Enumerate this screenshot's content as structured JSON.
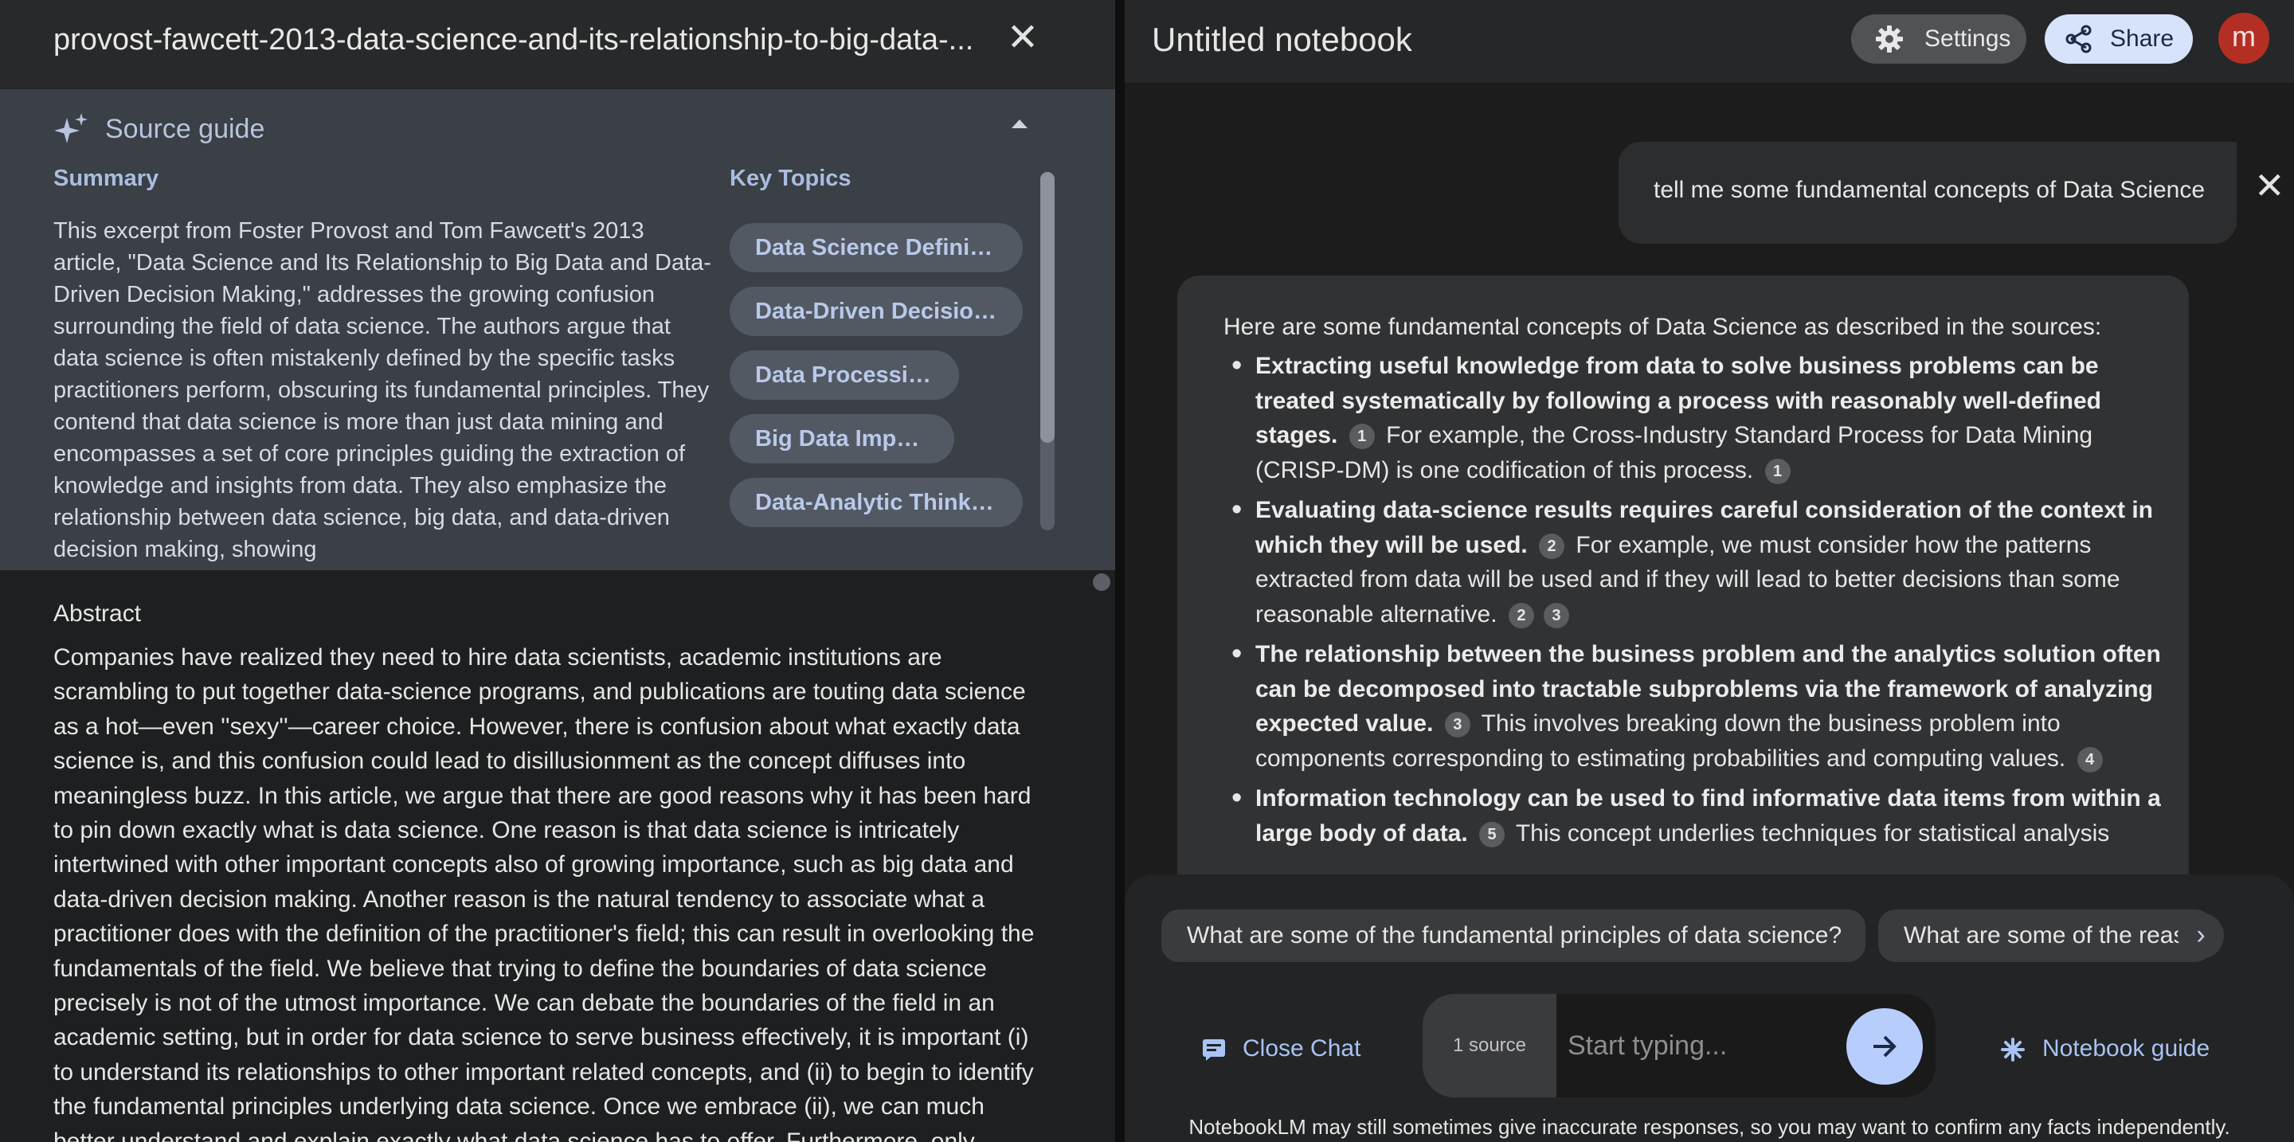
{
  "source_panel": {
    "title": "provost-fawcett-2013-data-science-and-its-relationship-to-big-data-...",
    "guide": {
      "label": "Source guide",
      "summary_label": "Summary",
      "summary_text": "This excerpt from Foster Provost and Tom Fawcett's 2013 article, \"Data Science and Its Relationship to Big Data and Data-Driven Decision Making,\" addresses the growing confusion surrounding the field of data science. The authors argue that data science is often mistakenly defined by the specific tasks practitioners perform, obscuring its fundamental principles. They contend that data science is more than just data mining and encompasses a set of core principles guiding the extraction of knowledge and insights from data. They also emphasize the relationship between data science, big data, and data-driven decision making, showing",
      "key_topics_label": "Key Topics",
      "key_topics": [
        "Data Science Definit…",
        "Data-Driven Decisio…",
        "Data Processing",
        "Big Data Impact",
        "Data-Analytic Thinki…"
      ]
    },
    "abstract_label": "Abstract",
    "abstract_text": "Companies have realized they need to hire data scientists, academic institutions are scrambling to put together data-science programs, and publications are touting data science as a hot—even ''sexy''—career choice. However, there is confusion about what exactly data science is, and this confusion could lead to disillusionment as the concept diffuses into meaningless buzz. In this article, we argue that there are good reasons why it has been hard to pin down exactly what is data science. One reason is that data science is intricately intertwined with other important concepts also of growing importance, such as big data and data-driven decision making. Another reason is the natural tendency to associate what a practitioner does with the definition of the practitioner's field; this can result in overlooking the fundamentals of the field. We believe that trying to define the boundaries of data science precisely is not of the utmost importance. We can debate the boundaries of the field in an academic setting, but in order for data science to serve business effectively, it is important (i) to understand its relationships to other important related concepts, and (ii) to begin to identify the fundamental principles underlying data science. Once we embrace (ii), we can much better understand and explain exactly what data science has to offer. Furthermore, only"
  },
  "notebook": {
    "title": "Untitled notebook",
    "settings_label": "Settings",
    "share_label": "Share",
    "avatar_letter": "m",
    "user_message": "tell me some fundamental concepts of Data Science",
    "answer": {
      "intro": "Here are some fundamental concepts of Data Science as described in the sources:",
      "bullets": [
        {
          "bold": "Extracting useful knowledge from data to solve business problems can be treated systematically by following a process with reasonably well-defined stages.",
          "cite1": "1",
          "rest": "For example, the Cross-Industry Standard Process for Data Mining (CRISP-DM) is one codification of this process.",
          "cite2": "1"
        },
        {
          "bold": "Evaluating data-science results requires careful consideration of the context in which they will be used.",
          "cite1": "2",
          "rest": "For example, we must consider how the patterns extracted from data will be used and if they will lead to better decisions than some reasonable alternative.",
          "cite2": "2",
          "cite3": "3"
        },
        {
          "bold": "The relationship between the business problem and the analytics solution often can be decomposed into tractable subproblems via the framework of analyzing expected value.",
          "cite1": "3",
          "rest": "This involves breaking down the business problem into components corresponding to estimating probabilities and computing values.",
          "cite2": "4"
        },
        {
          "bold": "Information technology can be used to find informative data items from within a large body of data.",
          "cite1": "5",
          "rest": "This concept underlies techniques for statistical analysis"
        }
      ]
    },
    "suggestions": [
      "What are some of the fundamental principles of data science?",
      "What are some of the reasons why it has been hard to define data science?"
    ],
    "close_chat_label": "Close Chat",
    "source_count": "1 source",
    "input_placeholder": "Start typing...",
    "notebook_guide_label": "Notebook guide",
    "disclaimer": "NotebookLM may still sometimes give inaccurate responses, so you may want to confirm any facts independently."
  }
}
